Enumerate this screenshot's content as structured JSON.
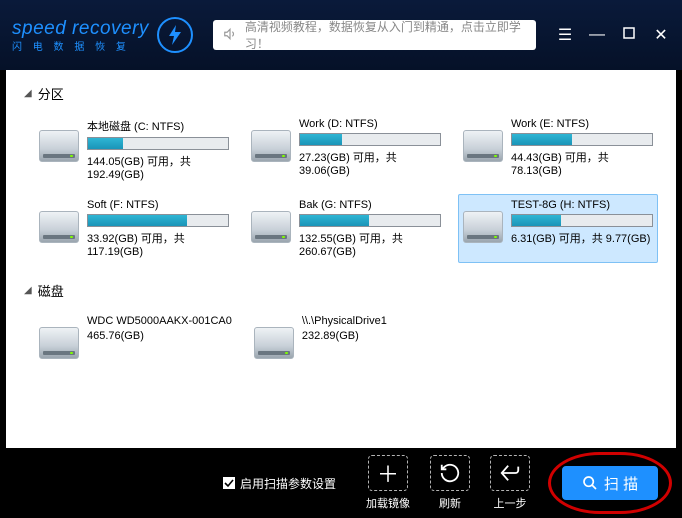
{
  "header": {
    "logo_main": "speed recovery",
    "logo_sub": "闪 电 数 据 恢 复",
    "banner_text": "高清视频教程，数据恢复从入门到精通，点击立即学习！"
  },
  "sections": {
    "partitions": "分区",
    "disks": "磁盘"
  },
  "partitions": [
    {
      "name": "本地磁盘 (C: NTFS)",
      "free": "144.05(GB)",
      "sep": "可用，共",
      "total": "192.49(GB)",
      "pct": 25
    },
    {
      "name": "Work (D: NTFS)",
      "free": "27.23(GB)",
      "sep": "可用，共",
      "total": "39.06(GB)",
      "pct": 30
    },
    {
      "name": "Work (E: NTFS)",
      "free": "44.43(GB)",
      "sep": "可用，共",
      "total": "78.13(GB)",
      "pct": 43
    },
    {
      "name": "Soft (F: NTFS)",
      "free": "33.92(GB)",
      "sep": "可用，共",
      "total": "117.19(GB)",
      "pct": 71
    },
    {
      "name": "Bak (G: NTFS)",
      "free": "132.55(GB)",
      "sep": "可用，共",
      "total": "260.67(GB)",
      "pct": 49
    },
    {
      "name": "TEST-8G (H: NTFS)",
      "free": "6.31(GB)",
      "sep": "可用，共",
      "total": "9.77(GB)",
      "pct": 35,
      "selected": true
    }
  ],
  "disks": [
    {
      "name": "WDC WD5000AAKX-001CA0",
      "size": "465.76(GB)"
    },
    {
      "name": "\\\\.\\PhysicalDrive1",
      "size": "232.89(GB)"
    }
  ],
  "footer": {
    "checkbox_label": "启用扫描参数设置",
    "load_image": "加载镜像",
    "refresh": "刷新",
    "back": "上一步",
    "scan": "扫 描"
  }
}
